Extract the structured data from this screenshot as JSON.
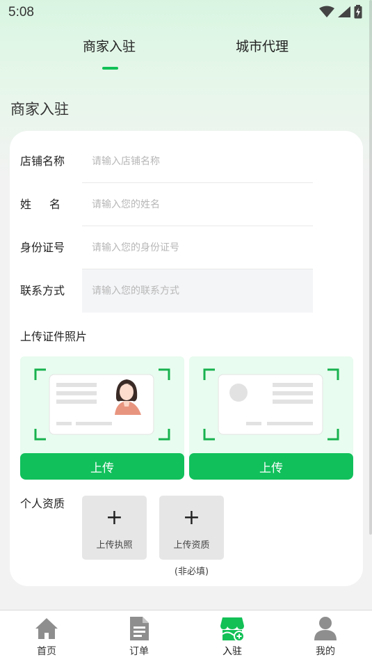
{
  "status_bar": {
    "time": "5:08"
  },
  "tabs": [
    {
      "label": "商家入驻",
      "active": true
    },
    {
      "label": "城市代理",
      "active": false
    }
  ],
  "section_title": "商家入驻",
  "form": {
    "store_name": {
      "label": "店铺名称",
      "placeholder": "请输入店铺名称",
      "value": ""
    },
    "name": {
      "label": "姓名",
      "placeholder": "请输入您的姓名",
      "value": ""
    },
    "id_number": {
      "label": "身份证号",
      "placeholder": "请输入您的身份证号",
      "value": ""
    },
    "contact": {
      "label": "联系方式",
      "placeholder": "请输入您的联系方式",
      "value": ""
    }
  },
  "upload_section": {
    "title": "上传证件照片",
    "front_button": "上传",
    "back_button": "上传"
  },
  "qualification": {
    "label": "个人资质",
    "license_label": "上传执照",
    "cert_label": "上传资质",
    "plus": "+",
    "optional_note": "(非必填)"
  },
  "bottom_nav": [
    {
      "label": "首页",
      "icon": "home-icon",
      "active": false
    },
    {
      "label": "订单",
      "icon": "document-icon",
      "active": false
    },
    {
      "label": "入驻",
      "icon": "store-icon",
      "active": true
    },
    {
      "label": "我的",
      "icon": "person-icon",
      "active": false
    }
  ],
  "colors": {
    "accent": "#12c056",
    "panel_bg": "#e8fcef",
    "icon_gray": "#8e8e8e"
  }
}
